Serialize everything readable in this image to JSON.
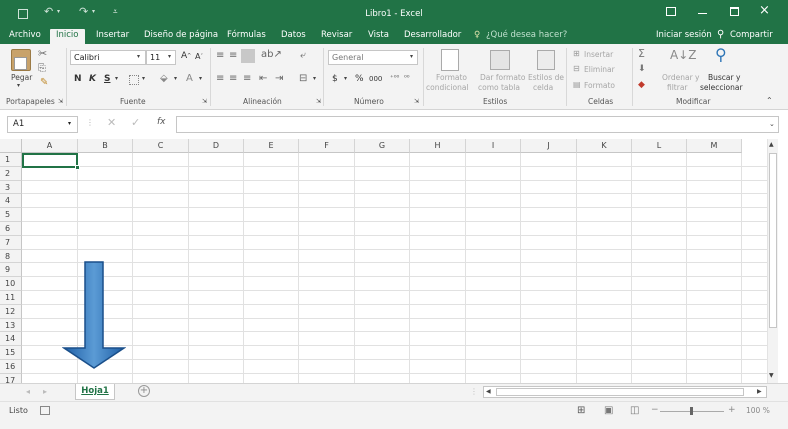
{
  "window": {
    "title": "Libro1 - Excel",
    "signin": "Iniciar sesión",
    "share": "Compartir"
  },
  "tabs": [
    "Archivo",
    "Inicio",
    "Insertar",
    "Diseño de página",
    "Fórmulas",
    "Datos",
    "Revisar",
    "Vista",
    "Desarrollador"
  ],
  "tell_me": "¿Qué desea hacer?",
  "ribbon": {
    "clipboard": {
      "paste": "Pegar",
      "label": "Portapapeles"
    },
    "font": {
      "name": "Calibri",
      "size": "11",
      "bold": "N",
      "italic": "K",
      "underline": "S",
      "label": "Fuente"
    },
    "alignment": {
      "label": "Alineación"
    },
    "number": {
      "format": "General",
      "currency": "$",
      "percent": "%",
      "thousands": "000",
      "label": "Número"
    },
    "styles": {
      "cond1": "Formato",
      "cond2": "condicional",
      "table1": "Dar formato",
      "table2": "como tabla",
      "cell1": "Estilos de",
      "cell2": "celda",
      "label": "Estilos"
    },
    "cells": {
      "insert": "Insertar",
      "delete": "Eliminar",
      "format": "Formato",
      "label": "Celdas"
    },
    "editing": {
      "sort1": "Ordenar y",
      "sort2": "filtrar",
      "find1": "Buscar y",
      "find2": "seleccionar",
      "label": "Modificar"
    }
  },
  "namebox": "A1",
  "fx": "fx",
  "columns": [
    "A",
    "B",
    "C",
    "D",
    "E",
    "F",
    "G",
    "H",
    "I",
    "J",
    "K",
    "L",
    "M"
  ],
  "rows": [
    "1",
    "2",
    "3",
    "4",
    "5",
    "6",
    "7",
    "8",
    "9",
    "10",
    "11",
    "12",
    "13",
    "14",
    "15",
    "16",
    "17"
  ],
  "sheet": {
    "name": "Hoja1",
    "add": "+"
  },
  "status": {
    "ready": "Listo",
    "zoom": "100 %"
  },
  "colors": {
    "excel_green": "#217346",
    "arrow_blue": "#2e75b6"
  }
}
